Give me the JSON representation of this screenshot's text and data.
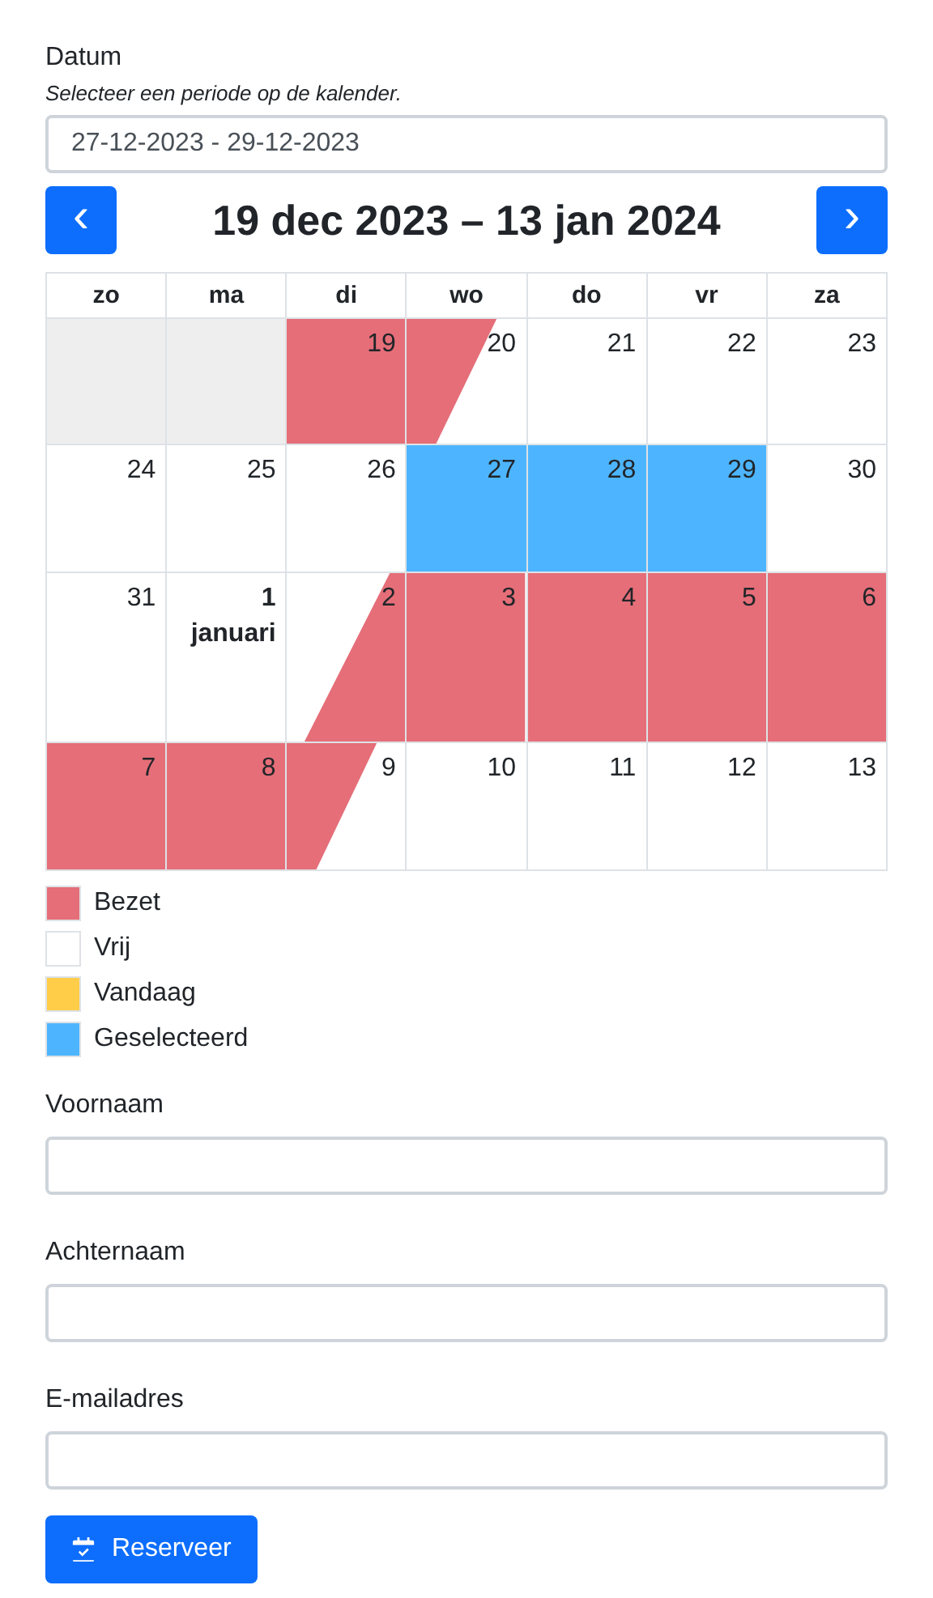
{
  "date_field": {
    "label": "Datum",
    "hint": "Selecteer een periode op de kalender.",
    "value": "27-12-2023 - 29-12-2023"
  },
  "calendar": {
    "prev_button": "‹",
    "next_button": "›",
    "title": "19 dec 2023 – 13 jan 2024",
    "weekdays": [
      "zo",
      "ma",
      "di",
      "wo",
      "do",
      "vr",
      "za"
    ],
    "weeks": [
      [
        {
          "kind": "past"
        },
        {
          "kind": "past"
        },
        {
          "day": "19",
          "kind": "booked"
        },
        {
          "day": "20",
          "kind": "checkout"
        },
        {
          "day": "21",
          "kind": "free"
        },
        {
          "day": "22",
          "kind": "free"
        },
        {
          "day": "23",
          "kind": "free"
        }
      ],
      [
        {
          "day": "24",
          "kind": "free"
        },
        {
          "day": "25",
          "kind": "free"
        },
        {
          "day": "26",
          "kind": "free"
        },
        {
          "day": "27",
          "kind": "selected"
        },
        {
          "day": "28",
          "kind": "selected"
        },
        {
          "day": "29",
          "kind": "selected"
        },
        {
          "day": "30",
          "kind": "free"
        }
      ],
      [
        {
          "day": "31",
          "kind": "free"
        },
        {
          "day": "1",
          "month_label": "januari",
          "kind": "free"
        },
        {
          "day": "2",
          "kind": "checkin"
        },
        {
          "day": "3",
          "kind": "booked"
        },
        {
          "day": "4",
          "kind": "booked"
        },
        {
          "day": "5",
          "kind": "booked"
        },
        {
          "day": "6",
          "kind": "booked"
        }
      ],
      [
        {
          "day": "7",
          "kind": "booked"
        },
        {
          "day": "8",
          "kind": "booked"
        },
        {
          "day": "9",
          "kind": "checkout"
        },
        {
          "day": "10",
          "kind": "free"
        },
        {
          "day": "11",
          "kind": "free"
        },
        {
          "day": "12",
          "kind": "free"
        },
        {
          "day": "13",
          "kind": "free"
        }
      ]
    ]
  },
  "legend": [
    {
      "label": "Bezet",
      "color": "#e56e78"
    },
    {
      "label": "Vrij",
      "color": "#ffffff"
    },
    {
      "label": "Vandaag",
      "color": "#ffcd48"
    },
    {
      "label": "Geselecteerd",
      "color": "#4db5ff"
    }
  ],
  "fields": [
    {
      "label": "Voornaam"
    },
    {
      "label": "Achternaam"
    },
    {
      "label": "E-mailadres"
    }
  ],
  "submit_button": "Reserveer"
}
